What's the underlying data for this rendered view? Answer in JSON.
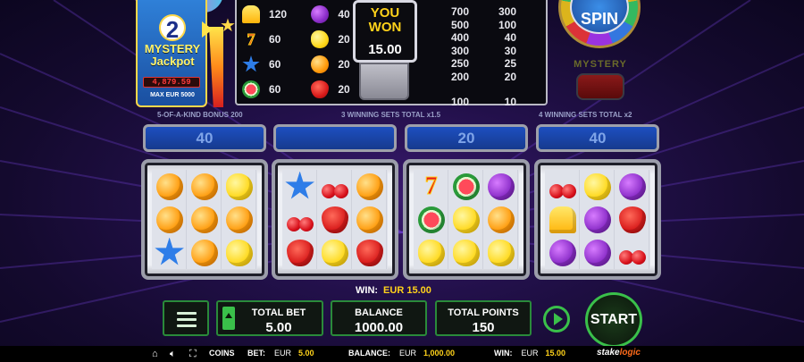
{
  "jackpot": {
    "number": "2",
    "title_line1": "MYSTERY",
    "title_line2": "Jackpot",
    "counter": "4,879.59",
    "max_text": "MAX EUR 5000"
  },
  "paytable": {
    "left_values": [
      "120",
      "60",
      "60",
      "60"
    ],
    "right_values": [
      "40",
      "20",
      "20",
      "20"
    ],
    "multipliers_a": [
      "700",
      "500",
      "400",
      "300",
      "250",
      "200",
      "",
      "100"
    ],
    "multipliers_b": [
      "300",
      "100",
      "40",
      "30",
      "25",
      "20",
      "",
      "10"
    ]
  },
  "you_won": {
    "line1": "YOU",
    "line2": "WON",
    "amount": "15.00"
  },
  "spin_label": "SPIN",
  "mystery_label": "MYSTERY",
  "section_labels": {
    "five_kind": "5-OF-A-KIND BONUS 200",
    "three_sets": "3 WINNING SETS TOTAL x1.5",
    "four_sets": "4 WINNING SETS TOTAL x2"
  },
  "reel_values": [
    "40",
    "",
    "20",
    "40"
  ],
  "reels": [
    [
      "orange",
      "orange",
      "lemon",
      "orange",
      "orange",
      "orange",
      "star",
      "orange",
      "lemon"
    ],
    [
      "star",
      "cherry",
      "orange",
      "cherry",
      "straw",
      "orange",
      "straw",
      "lemon",
      "straw"
    ],
    [
      "seven",
      "melon",
      "plum",
      "melon",
      "lemon",
      "orange",
      "lemon",
      "lemon",
      "lemon"
    ],
    [
      "cherry",
      "lemon",
      "plum",
      "bell",
      "plum",
      "straw",
      "plum",
      "plum",
      "cherry"
    ]
  ],
  "win": {
    "label": "WIN:",
    "amount": "EUR 15.00"
  },
  "panel": {
    "total_bet_label": "TOTAL BET",
    "total_bet_value": "5.00",
    "balance_label": "BALANCE",
    "balance_value": "1000.00",
    "total_points_label": "TOTAL POINTS",
    "total_points_value": "150",
    "start_label": "START"
  },
  "status_bar": {
    "coins_label": "COINS",
    "bet_label": "BET:",
    "bet_currency": "EUR",
    "bet_value": "5.00",
    "balance_label": "BALANCE:",
    "balance_currency": "EUR",
    "balance_value": "1,000.00",
    "win_label": "WIN:",
    "win_currency": "EUR",
    "win_value": "15.00",
    "brand_a": "stake",
    "brand_b": "logic"
  },
  "colors": {
    "accent_green": "#3ac04a",
    "gold": "#ffd21a",
    "bar_blue": "#1d4fc0"
  },
  "icons": {
    "home": "home-icon",
    "sound": "sound-icon",
    "fullscreen": "fullscreen-icon",
    "menu": "menu-icon",
    "replay": "replay-icon"
  }
}
